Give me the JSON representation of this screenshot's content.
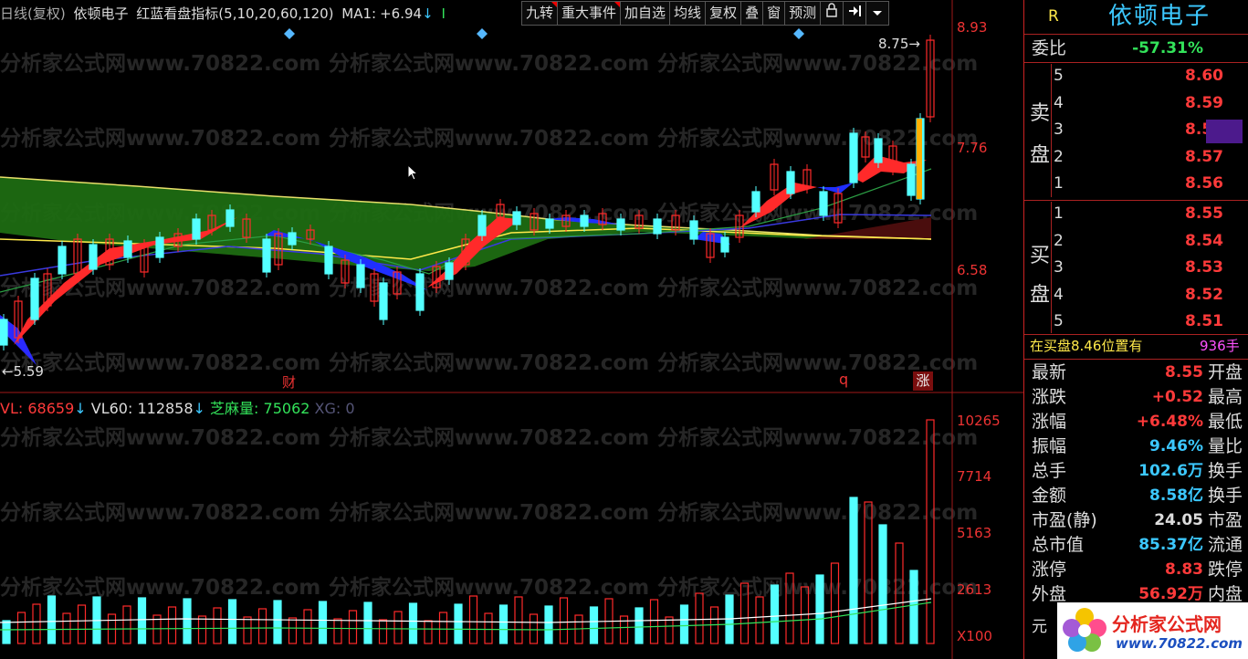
{
  "header": {
    "period": "日线(复权)",
    "stock_name": "依顿电子",
    "indicator": "红蓝看盘指标(5,10,20,60,120)",
    "ma1_label": "MA1:",
    "ma1_value": "+6.94",
    "ma1_arrow": "↓",
    "tail_mark": "I"
  },
  "toolbar": {
    "buttons": [
      "九转",
      "重大事件",
      "加自选",
      "均线",
      "复权",
      "叠",
      "窗",
      "预测"
    ],
    "lock_icon": "lock-icon",
    "next_icon": "skip-next-icon",
    "menu_icon": "dropdown-icon"
  },
  "price_axis": [
    "8.93",
    "7.76",
    "6.58"
  ],
  "price_markers": {
    "high": "8.75",
    "low": "5.59"
  },
  "event_marks": {
    "finance": "财",
    "q": "q",
    "limit_up": "涨"
  },
  "volume_header": {
    "vl_label": "VL:",
    "vl_value": "68659",
    "vl_arrow": "↓",
    "vl60_label": "VL60:",
    "vl60_value": "112858",
    "vl60_arrow": "↓",
    "zmd_label": "芝麻量:",
    "zmd_value": "75062",
    "xg_label": "XG:",
    "xg_value": "0"
  },
  "volume_axis": [
    "10265",
    "7714",
    "5163",
    "2613",
    "X100"
  ],
  "watermark": "分析家公式网www.70822.com",
  "panel": {
    "r_mark": "R",
    "title": "依顿电子",
    "weibi_label": "委比",
    "weibi_value": "-57.31%",
    "sell_label_1": "卖",
    "sell_label_2": "盘",
    "buy_label_1": "买",
    "buy_label_2": "盘",
    "sell": [
      {
        "level": "5",
        "price": "8.60"
      },
      {
        "level": "4",
        "price": "8.59"
      },
      {
        "level": "3",
        "price": "8.58"
      },
      {
        "level": "2",
        "price": "8.57"
      },
      {
        "level": "1",
        "price": "8.56"
      }
    ],
    "buy": [
      {
        "level": "1",
        "price": "8.55"
      },
      {
        "level": "2",
        "price": "8.54"
      },
      {
        "level": "3",
        "price": "8.53"
      },
      {
        "level": "4",
        "price": "8.52"
      },
      {
        "level": "5",
        "price": "8.51"
      }
    ],
    "position_text": "在买盘8.46位置有",
    "position_qty": "936手",
    "stats": [
      {
        "label": "最新",
        "value": "8.55",
        "side": "开盘",
        "color": "#ff3a3a"
      },
      {
        "label": "涨跌",
        "value": "+0.52",
        "side": "最高",
        "color": "#ff3a3a"
      },
      {
        "label": "涨幅",
        "value": "+6.48%",
        "side": "最低",
        "color": "#ff3a3a"
      },
      {
        "label": "振幅",
        "value": "9.46%",
        "side": "量比",
        "color": "#3cc8ff"
      },
      {
        "label": "总手",
        "value": "102.6万",
        "side": "换手",
        "color": "#3cc8ff"
      },
      {
        "label": "金额",
        "value": "8.58亿",
        "side": "换手",
        "color": "#3cc8ff"
      },
      {
        "label": "市盈(静)",
        "value": "24.05",
        "side": "市盈",
        "color": "#dddddd"
      },
      {
        "label": "总市值",
        "value": "85.37亿",
        "side": "流通",
        "color": "#3cc8ff"
      },
      {
        "label": "涨停",
        "value": "8.83",
        "side": "跌停",
        "color": "#ff3a3a"
      },
      {
        "label": "外盘",
        "value": "56.92万",
        "side": "内盘",
        "color": "#ff3a3a"
      }
    ],
    "yuan_label": "元",
    "logo_text": "分析家公式网",
    "logo_url": "www.70822.com"
  },
  "colors": {
    "up": "#ff2a2a",
    "down": "#54ffff",
    "grid": "#a01818",
    "axis": "#e33"
  }
}
